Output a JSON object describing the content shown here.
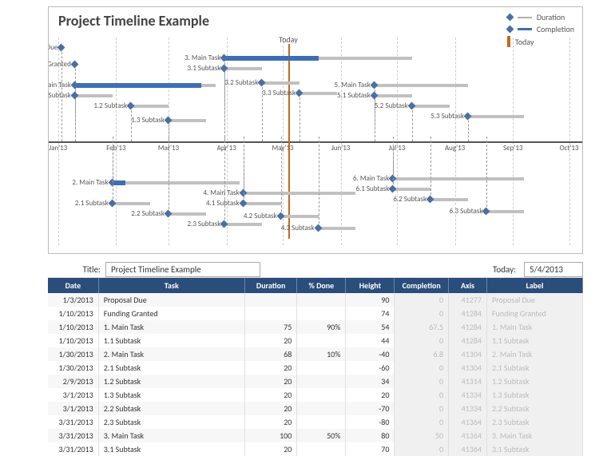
{
  "meta": {
    "title_label": "Title:",
    "title_value": "Project Timeline Example",
    "today_label": "Today:",
    "today_value": "5/4/2013"
  },
  "headers": [
    "Date",
    "Task",
    "Duration",
    "% Done",
    "Height",
    "Completion",
    "Axis",
    "Label"
  ],
  "rows": [
    {
      "date": "1/3/2013",
      "task": "Proposal Due",
      "duration": "",
      "pct": "",
      "height": "90",
      "comp": "0",
      "axis": "41277",
      "label": "Proposal Due"
    },
    {
      "date": "1/10/2013",
      "task": "Funding Granted",
      "duration": "",
      "pct": "",
      "height": "74",
      "comp": "0",
      "axis": "41284",
      "label": "Funding Granted"
    },
    {
      "date": "1/10/2013",
      "task": "1. Main Task",
      "duration": "75",
      "pct": "90%",
      "height": "54",
      "comp": "67.5",
      "axis": "41284",
      "label": "1. Main Task"
    },
    {
      "date": "1/10/2013",
      "task": "1.1 Subtask",
      "duration": "20",
      "pct": "",
      "height": "44",
      "comp": "0",
      "axis": "41284",
      "label": "1.1 Subtask"
    },
    {
      "date": "1/30/2013",
      "task": "2. Main Task",
      "duration": "68",
      "pct": "10%",
      "height": "-40",
      "comp": "6.8",
      "axis": "41304",
      "label": "2. Main Task"
    },
    {
      "date": "1/30/2013",
      "task": "2.1 Subtask",
      "duration": "20",
      "pct": "",
      "height": "-60",
      "comp": "0",
      "axis": "41304",
      "label": "2.1 Subtask"
    },
    {
      "date": "2/9/2013",
      "task": "1.2 Subtask",
      "duration": "20",
      "pct": "",
      "height": "34",
      "comp": "0",
      "axis": "41314",
      "label": "1.2 Subtask"
    },
    {
      "date": "3/1/2013",
      "task": "1.3 Subtask",
      "duration": "20",
      "pct": "",
      "height": "20",
      "comp": "0",
      "axis": "41334",
      "label": "1.3 Subtask"
    },
    {
      "date": "3/1/2013",
      "task": "2.2 Subtask",
      "duration": "20",
      "pct": "",
      "height": "-70",
      "comp": "0",
      "axis": "41334",
      "label": "2.2 Subtask"
    },
    {
      "date": "3/31/2013",
      "task": "2.3 Subtask",
      "duration": "20",
      "pct": "",
      "height": "-80",
      "comp": "0",
      "axis": "41364",
      "label": "2.3 Subtask"
    },
    {
      "date": "3/31/2013",
      "task": "3. Main Task",
      "duration": "100",
      "pct": "50%",
      "height": "80",
      "comp": "50",
      "axis": "41364",
      "label": "3. Main Task"
    },
    {
      "date": "3/31/2013",
      "task": "3.1 Subtask",
      "duration": "20",
      "pct": "",
      "height": "70",
      "comp": "0",
      "axis": "41364",
      "label": "3.1 Subtask"
    }
  ],
  "chart_data": {
    "type": "gantt-timeline",
    "title": "Project Timeline Example",
    "today_label": "Today",
    "today_date": "5/4/2013",
    "today_axis": 41398,
    "x_ticks": [
      {
        "label": "Jan'13",
        "axis": 41275
      },
      {
        "label": "Feb'13",
        "axis": 41306
      },
      {
        "label": "Mar'13",
        "axis": 41334
      },
      {
        "label": "Apr'13",
        "axis": 41365
      },
      {
        "label": "May'13",
        "axis": 41395
      },
      {
        "label": "Jun'13",
        "axis": 41426
      },
      {
        "label": "Jul'13",
        "axis": 41456
      },
      {
        "label": "Aug'13",
        "axis": 41487
      },
      {
        "label": "Sep'13",
        "axis": 41518
      },
      {
        "label": "Oct'13",
        "axis": 41548
      }
    ],
    "x_range": [
      41270,
      41555
    ],
    "y_range": [
      -100,
      100
    ],
    "legend": {
      "duration": "Duration",
      "completion": "Completion",
      "today": "Today"
    },
    "tasks": [
      {
        "label": "Proposal Due",
        "start": 41277,
        "duration": 0,
        "height": 90,
        "completion": 0
      },
      {
        "label": "Funding Granted",
        "start": 41284,
        "duration": 0,
        "height": 74,
        "completion": 0
      },
      {
        "label": "1. Main Task",
        "start": 41284,
        "duration": 75,
        "height": 54,
        "completion": 67.5
      },
      {
        "label": "1.1 Subtask",
        "start": 41284,
        "duration": 20,
        "height": 44,
        "completion": 0
      },
      {
        "label": "1.2 Subtask",
        "start": 41314,
        "duration": 20,
        "height": 34,
        "completion": 0
      },
      {
        "label": "1.3 Subtask",
        "start": 41334,
        "duration": 20,
        "height": 20,
        "completion": 0
      },
      {
        "label": "3. Main Task",
        "start": 41364,
        "duration": 100,
        "height": 80,
        "completion": 50
      },
      {
        "label": "3.1 Subtask",
        "start": 41364,
        "duration": 20,
        "height": 70,
        "completion": 0
      },
      {
        "label": "3.2 Subtask",
        "start": 41384,
        "duration": 20,
        "height": 56,
        "completion": 0
      },
      {
        "label": "3.3 Subtask",
        "start": 41404,
        "duration": 20,
        "height": 46,
        "completion": 0
      },
      {
        "label": "5. Main Task",
        "start": 41444,
        "duration": 50,
        "height": 54,
        "completion": 0
      },
      {
        "label": "5.1 Subtask",
        "start": 41444,
        "duration": 20,
        "height": 44,
        "completion": 0
      },
      {
        "label": "5.2 Subtask",
        "start": 41464,
        "duration": 20,
        "height": 34,
        "completion": 0
      },
      {
        "label": "5.3 Subtask",
        "start": 41494,
        "duration": 30,
        "height": 24,
        "completion": 0
      },
      {
        "label": "2. Main Task",
        "start": 41304,
        "duration": 68,
        "height": -40,
        "completion": 6.8
      },
      {
        "label": "2.1 Subtask",
        "start": 41304,
        "duration": 20,
        "height": -60,
        "completion": 0
      },
      {
        "label": "2.2 Subtask",
        "start": 41334,
        "duration": 20,
        "height": -70,
        "completion": 0
      },
      {
        "label": "2.3 Subtask",
        "start": 41364,
        "duration": 20,
        "height": -80,
        "completion": 0
      },
      {
        "label": "4. Main Task",
        "start": 41374,
        "duration": 60,
        "height": -50,
        "completion": 0
      },
      {
        "label": "4.1 Subtask",
        "start": 41374,
        "duration": 20,
        "height": -60,
        "completion": 0
      },
      {
        "label": "4.2 Subtask",
        "start": 41394,
        "duration": 20,
        "height": -72,
        "completion": 0
      },
      {
        "label": "4.3 Subtask",
        "start": 41414,
        "duration": 20,
        "height": -84,
        "completion": 0
      },
      {
        "label": "6. Main Task",
        "start": 41454,
        "duration": 70,
        "height": -36,
        "completion": 0
      },
      {
        "label": "6.1 Subtask",
        "start": 41454,
        "duration": 20,
        "height": -46,
        "completion": 0
      },
      {
        "label": "6.2 Subtask",
        "start": 41474,
        "duration": 20,
        "height": -56,
        "completion": 0
      },
      {
        "label": "6.3 Subtask",
        "start": 41504,
        "duration": 20,
        "height": -68,
        "completion": 0
      }
    ]
  }
}
